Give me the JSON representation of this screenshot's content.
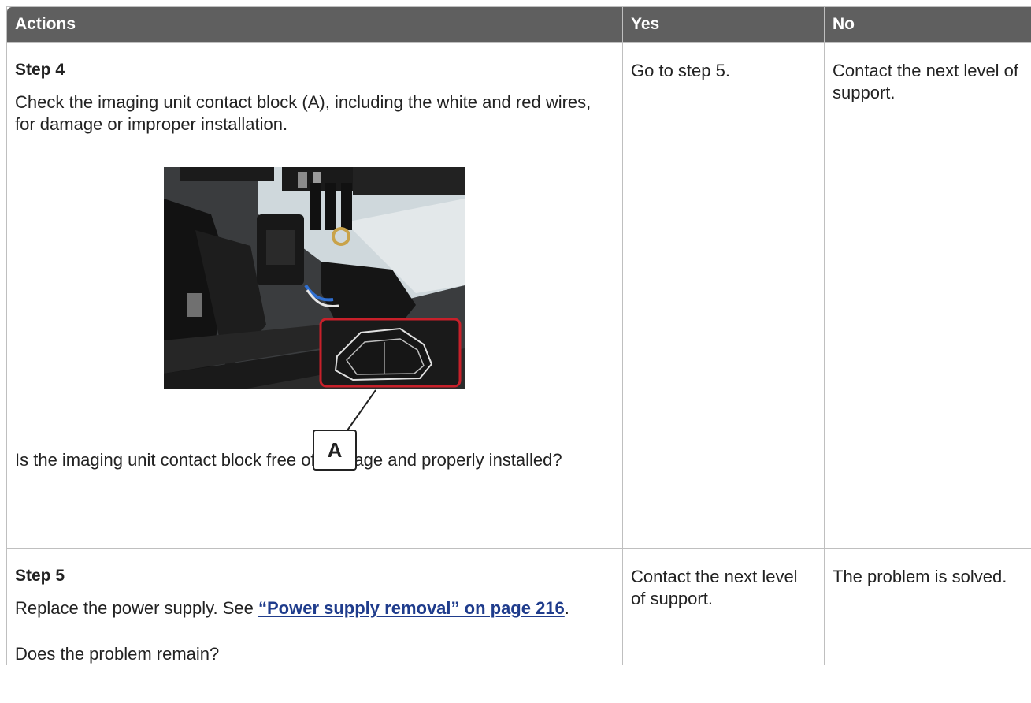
{
  "headers": {
    "actions": "Actions",
    "yes": "Yes",
    "no": "No"
  },
  "step4": {
    "title": "Step 4",
    "instruction": "Check the imaging unit contact block (A), including the white and red wires, for damage or improper installation.",
    "callout_label": "A",
    "question": "Is the imaging unit contact block free of damage and properly installed?",
    "yes": "Go to step 5.",
    "no": "Contact the next level of support."
  },
  "step5": {
    "title": "Step 5",
    "instruction_prefix": "Replace the power supply. See ",
    "link_text": "“Power supply removal” on page 216",
    "instruction_suffix": ".",
    "question": "Does the problem remain?",
    "yes": "Contact the next level of support.",
    "no": "The problem is solved."
  },
  "colors": {
    "header_bg": "#5f5f5f",
    "border": "#bfbfbf",
    "link": "#1f3c8c",
    "callout_red": "#c8202a"
  }
}
